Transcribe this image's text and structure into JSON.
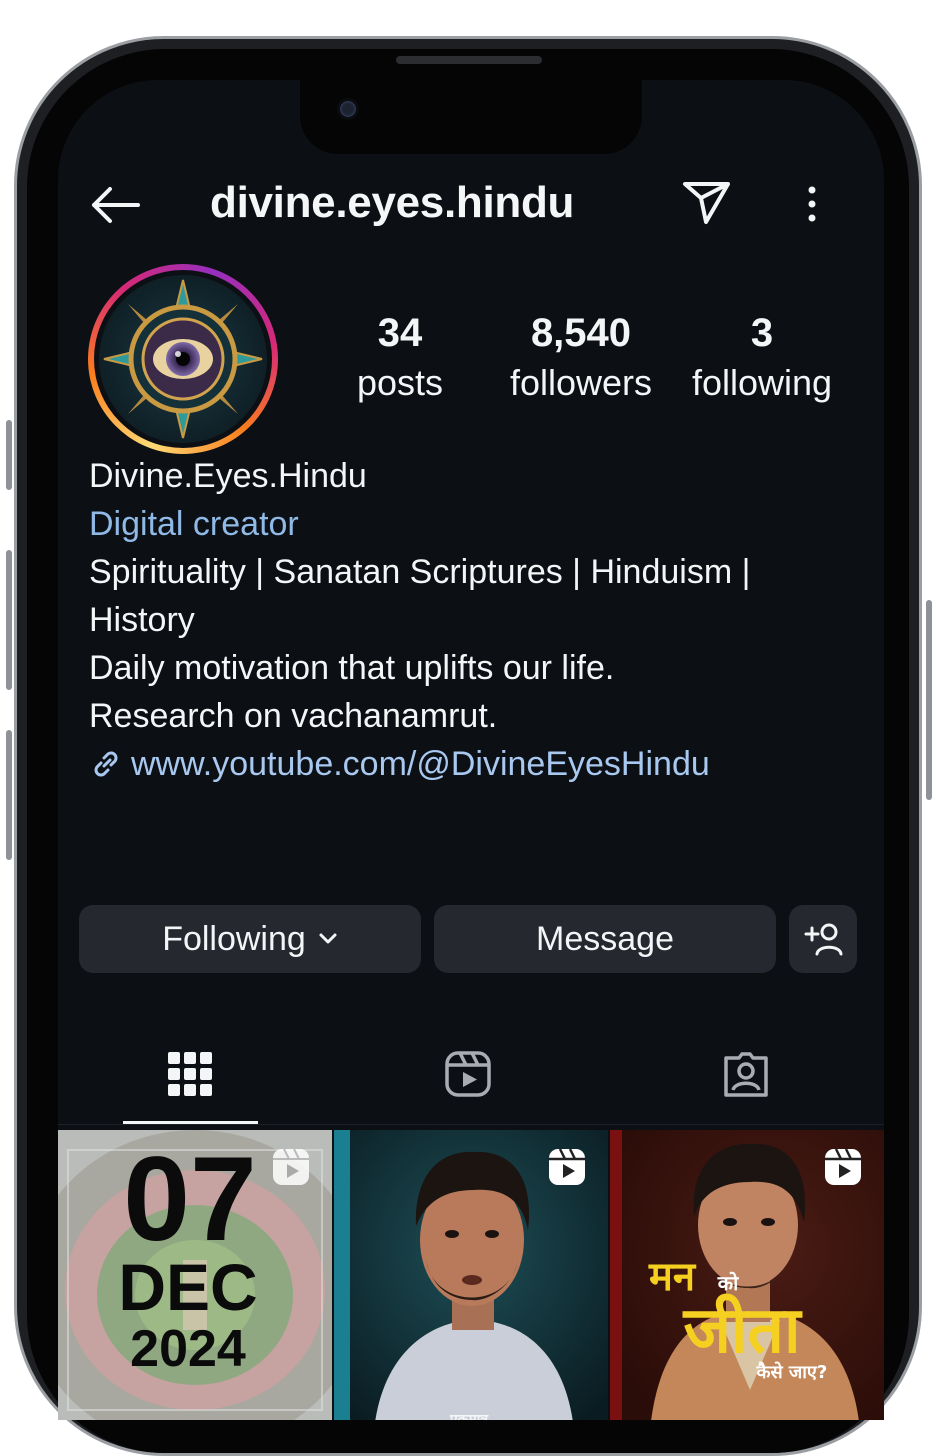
{
  "header": {
    "username": "divine.eyes.hindu",
    "back_icon": "arrow-left-icon",
    "send_icon": "paper-plane-icon",
    "more_icon": "vertical-dots-icon"
  },
  "stats": [
    {
      "value": "34",
      "label": "posts"
    },
    {
      "value": "8,540",
      "label": "followers"
    },
    {
      "value": "3",
      "label": "following"
    }
  ],
  "bio": {
    "name": "Divine.Eyes.Hindu",
    "category": "Digital creator",
    "line1": "Spirituality | Sanatan Scriptures | Hinduism |",
    "line2": "History",
    "line3": "Daily motivation that uplifts our life.",
    "line4": "Research on vachanamrut.",
    "link": "www.youtube.com/@DivineEyesHindu"
  },
  "actions": {
    "following_label": "Following",
    "message_label": "Message",
    "add_user_icon": "add-person-icon"
  },
  "tabs": [
    {
      "name": "posts-grid",
      "icon": "grid-icon",
      "active": true
    },
    {
      "name": "reels",
      "icon": "reels-icon",
      "active": false
    },
    {
      "name": "tagged",
      "icon": "tagged-person-icon",
      "active": false
    }
  ],
  "posts": [
    {
      "kind": "reel",
      "day": "07",
      "month": "DEC",
      "year": "2024"
    },
    {
      "kind": "reel",
      "caption": "एकमात्र"
    },
    {
      "kind": "reel",
      "line1": "मन",
      "line1b": "को",
      "line2": "जीता",
      "line3": "कैसे जाए?"
    }
  ],
  "colors": {
    "background": "#0c0f14",
    "button": "#25282e",
    "category": "#8fb9e6",
    "link": "#a8c8f0",
    "story_ring": [
      "#feda75",
      "#fa7e1e",
      "#d62976",
      "#962fbf"
    ]
  }
}
